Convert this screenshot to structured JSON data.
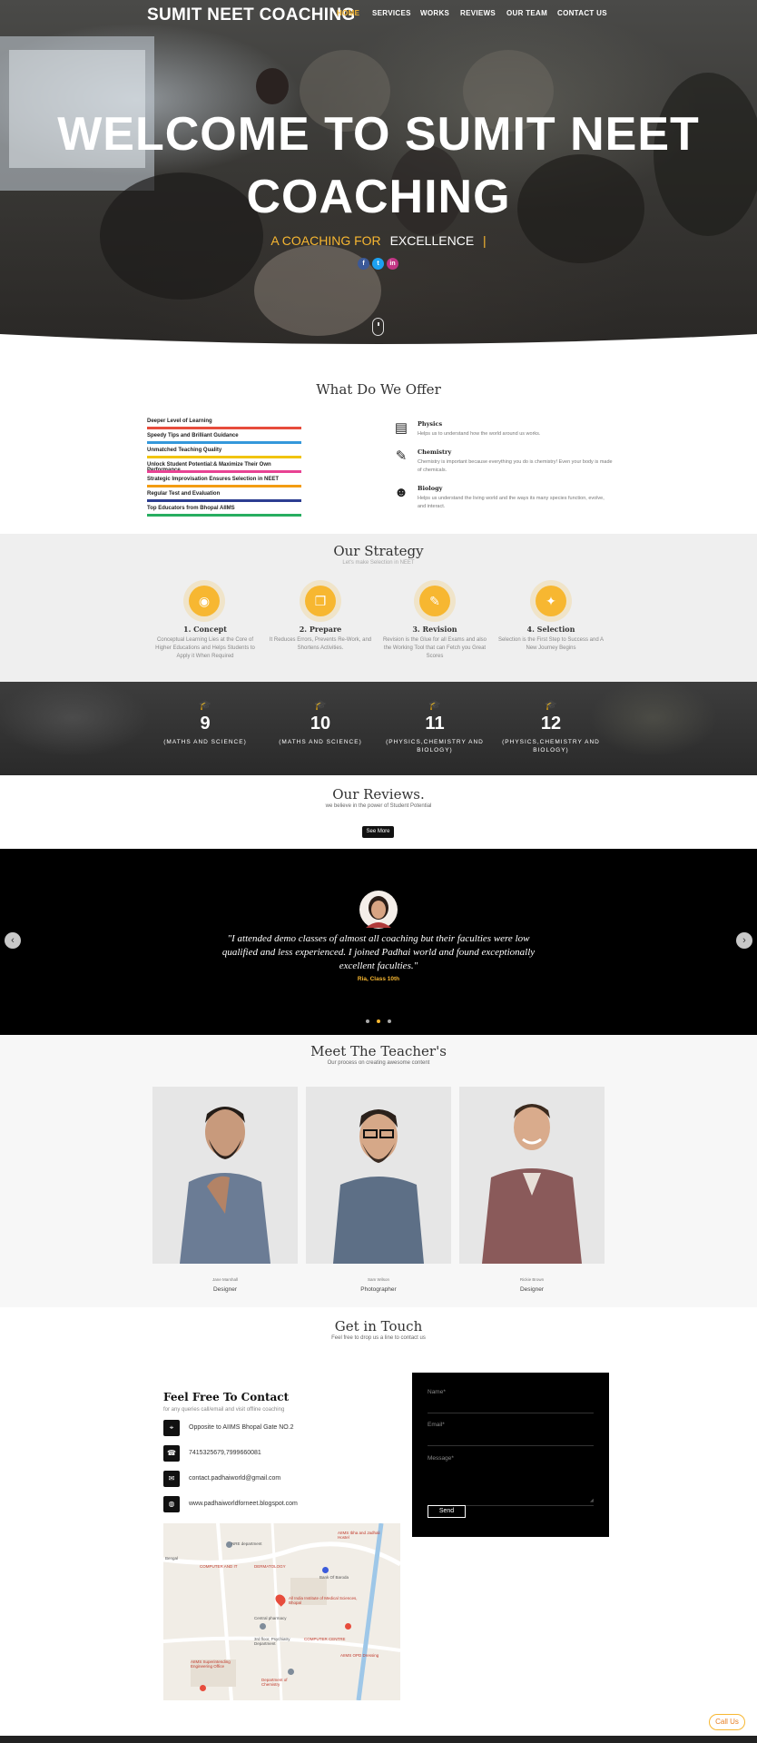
{
  "brand": "SUMIT NEET COACHING",
  "nav": [
    "HOME",
    "SERVICES",
    "WORKS",
    "REVIEWS",
    "OUR TEAM",
    "CONTACT US"
  ],
  "hero": {
    "title_line1": "WELCOME TO SUMIT NEET",
    "title_line2": "COACHING",
    "subtitle_prefix": "A COACHING FOR",
    "subtitle_word": "EXCELLENCE",
    "subtitle_cursor": "|",
    "social": [
      {
        "icon": "facebook-icon",
        "glyph": "f",
        "color": "#3b5998"
      },
      {
        "icon": "twitter-icon",
        "glyph": "t",
        "color": "#1da1f2"
      },
      {
        "icon": "instagram-icon",
        "glyph": "in",
        "color": "#c13584"
      }
    ]
  },
  "offer": {
    "title": "What Do We Offer",
    "bars": [
      {
        "label": "Deeper Level of Learning",
        "color": "#e74c3c"
      },
      {
        "label": "Speedy Tips and Brilliant Guidance",
        "color": "#3498db"
      },
      {
        "label": "Unmatched Teaching Quality",
        "color": "#f1c40f"
      },
      {
        "label": "Unlock Student Potential:& Maximize Their Own Performance",
        "color": "#e84393"
      },
      {
        "label": "Strategic Improvisation Ensures Selection in NEET",
        "color": "#f39c12"
      },
      {
        "label": "Regular Test and Evaluation",
        "color": "#2c3e91"
      },
      {
        "label": "Top Educators from Bhopal AIIMS",
        "color": "#27ae60"
      }
    ],
    "subjects": [
      {
        "title": "Physics",
        "text": "Helps us to understand how the world around us works.",
        "icon": "book-icon"
      },
      {
        "title": "Chemistry",
        "text": "Chemistry is important because everything you do is chemistry! Even your body is made of chemicals.",
        "icon": "flask-icon"
      },
      {
        "title": "Biology",
        "text": "Helps us understand the living world and the ways its many species function, evolve, and interact.",
        "icon": "student-icon"
      }
    ]
  },
  "strategy": {
    "title": "Our Strategy",
    "subtitle": "Let's make Selection in NEET",
    "steps": [
      {
        "title": "1. Concept",
        "text": "Conceptual Learning Lies at the Core of Higher Educations and Helps Students to Apply it When Required",
        "icon": "bulb-icon",
        "glyph": "💡"
      },
      {
        "title": "2. Prepare",
        "text": "It Reduces Errors, Prevents Re-Work, and Shortens Activities.",
        "icon": "copy-icon",
        "glyph": "❐"
      },
      {
        "title": "3. Revision",
        "text": "Revision is the Glue for all Exams and also the Working Tool that can Fetch you Great Scores",
        "icon": "brush-icon",
        "glyph": "✎"
      },
      {
        "title": "4. Selection",
        "text": "Selection is the First Step to Success and A New Journey Begins",
        "icon": "gift-icon",
        "glyph": "🎁"
      }
    ]
  },
  "counters": [
    {
      "value": "9",
      "label": "(MATHS AND SCIENCE)"
    },
    {
      "value": "10",
      "label": "(MATHS AND SCIENCE)"
    },
    {
      "value": "11",
      "label": "(PHYSICS,CHEMISTRY AND BIOLOGY)"
    },
    {
      "value": "12",
      "label": "(PHYSICS,CHEMISTRY AND BIOLOGY)"
    }
  ],
  "reviews": {
    "title": "Our Reviews.",
    "subtitle": "we believe in the power of Student Potential",
    "button": "See More",
    "quote": "\"I attended demo classes of almost all coaching but their faculties were low qualified and less experienced. I joined Padhai world and found exceptionally excellent faculties.\"",
    "author": "Ria, Class 10th",
    "prev": "‹",
    "next": "›"
  },
  "teachers": {
    "title": "Meet The Teacher's",
    "subtitle": "Our process on creating awesome content",
    "list": [
      {
        "name": "Jane Marshall",
        "role": "Designer"
      },
      {
        "name": "Sam Wilson",
        "role": "Photographer"
      },
      {
        "name": "Rickie Brown",
        "role": "Designer"
      }
    ]
  },
  "contact": {
    "title": "Get in Touch",
    "subtitle": "Feel free to drop us a line to contact us",
    "heading": "Feel Free To Contact",
    "intro": "for any queries call/email and visit offline coaching",
    "items": [
      {
        "icon": "location-icon",
        "glyph": "⌖",
        "text": "Opposite to AIIMS Bhopal Gate NO.2"
      },
      {
        "icon": "phone-icon",
        "glyph": "☎",
        "text": "7415325679,7999660081"
      },
      {
        "icon": "mail-icon",
        "glyph": "✉",
        "text": "contact.padhaiworld@gmail.com"
      },
      {
        "icon": "globe-icon",
        "glyph": "◍",
        "text": "www.padhaiworldforneet.blogspot.com"
      }
    ],
    "form": {
      "name_label": "Name*",
      "email_label": "Email*",
      "message_label": "Message*",
      "send": "Send"
    },
    "call_button": "Call Us"
  },
  "map": {
    "labels": [
      "NRE department",
      "COMPUTER AND IT",
      "DERMATOLOGY",
      "Bank Of Baroda",
      "All India Institute of Medical Sciences, Bhopal",
      "Central pharmacy",
      "3rd floor, Psychiatry Department",
      "AIIMS Ibha and Jadhali Hostel",
      "COMPUTER CENTRE",
      "AIIMS OPD Dressing",
      "AIIMS Superintending Engineering Office",
      "Department of Chemistry",
      "Bengal"
    ]
  }
}
